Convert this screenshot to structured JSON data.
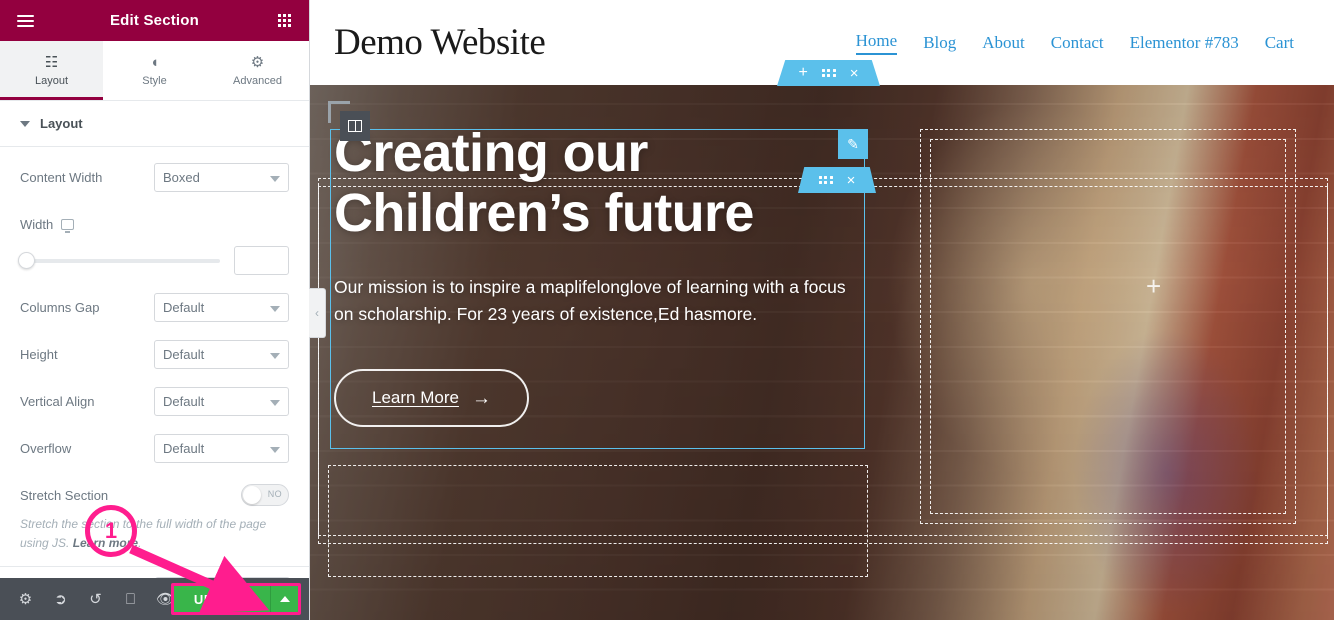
{
  "panel": {
    "header": {
      "title": "Edit Section",
      "menu_icon": "hamburger-menu-icon",
      "apps_icon": "grid-apps-icon"
    },
    "tabs": [
      {
        "label": "Layout",
        "icon": "columns-icon",
        "active": true
      },
      {
        "label": "Style",
        "icon": "half-circle-icon",
        "active": false
      },
      {
        "label": "Advanced",
        "icon": "gear-icon",
        "active": false
      }
    ],
    "section": {
      "title": "Layout",
      "expanded": true
    },
    "controls": [
      {
        "label": "Content Width",
        "type": "select",
        "value": "Boxed"
      },
      {
        "label": "Width",
        "type": "slider",
        "value": "",
        "device_icon": "desktop-icon"
      },
      {
        "label": "Columns Gap",
        "type": "select",
        "value": "Default"
      },
      {
        "label": "Height",
        "type": "select",
        "value": "Default"
      },
      {
        "label": "Vertical Align",
        "type": "select",
        "value": "Default"
      },
      {
        "label": "Overflow",
        "type": "select",
        "value": "Default"
      },
      {
        "label": "Stretch Section",
        "type": "switcher",
        "value": "NO"
      }
    ],
    "help": {
      "text_before": "Stretch the section to the full width of the page using JS. ",
      "link": "Learn more",
      "text_after": "."
    },
    "footer": {
      "icons": [
        {
          "name": "settings-gear-icon",
          "glyph": "⚙"
        },
        {
          "name": "navigator-layers-icon",
          "glyph": "≣"
        },
        {
          "name": "history-revisions-icon",
          "glyph": "↺"
        },
        {
          "name": "responsive-mode-icon",
          "glyph": "▢"
        },
        {
          "name": "preview-eye-icon",
          "glyph": "◉"
        }
      ],
      "update_label": "UPDATE",
      "update_caret": "caret-up-icon"
    },
    "collapse_arrow": "‹"
  },
  "site": {
    "title": "Demo Website",
    "nav": [
      {
        "label": "Home",
        "active": true
      },
      {
        "label": "Blog",
        "active": false
      },
      {
        "label": "About",
        "active": false
      },
      {
        "label": "Contact",
        "active": false
      },
      {
        "label": "Elementor #783",
        "active": false
      },
      {
        "label": "Cart",
        "active": false
      }
    ]
  },
  "hero": {
    "heading_line1": "Creating our",
    "heading_line2": "Children’s future",
    "paragraph": "Our mission is to inspire a maplifelonglove of learning with a focus on scholarship. For 23 years of existence,Ed hasmore.",
    "button_label": "Learn More",
    "button_arrow": "→",
    "add_widget_icon": "plus-icon"
  },
  "editor_handles": {
    "section_outer": {
      "add": "+",
      "drag": "grid-drag-icon",
      "close": "×"
    },
    "section_inner": {
      "drag": "grid-drag-icon",
      "close": "×"
    },
    "column": {
      "icon": "column-layout-icon"
    },
    "edit": {
      "icon": "pencil-edit-icon",
      "glyph": "✎"
    }
  },
  "annotation": {
    "step_number": "1",
    "color": "#ff1d8e"
  },
  "colors": {
    "panel_header": "#93003f",
    "accent_blue": "#5bc0eb",
    "update_green": "#39b54a",
    "annotation_pink": "#ff1d8e",
    "footer_dark": "#4a4f56",
    "nav_link": "#2b93d4"
  }
}
